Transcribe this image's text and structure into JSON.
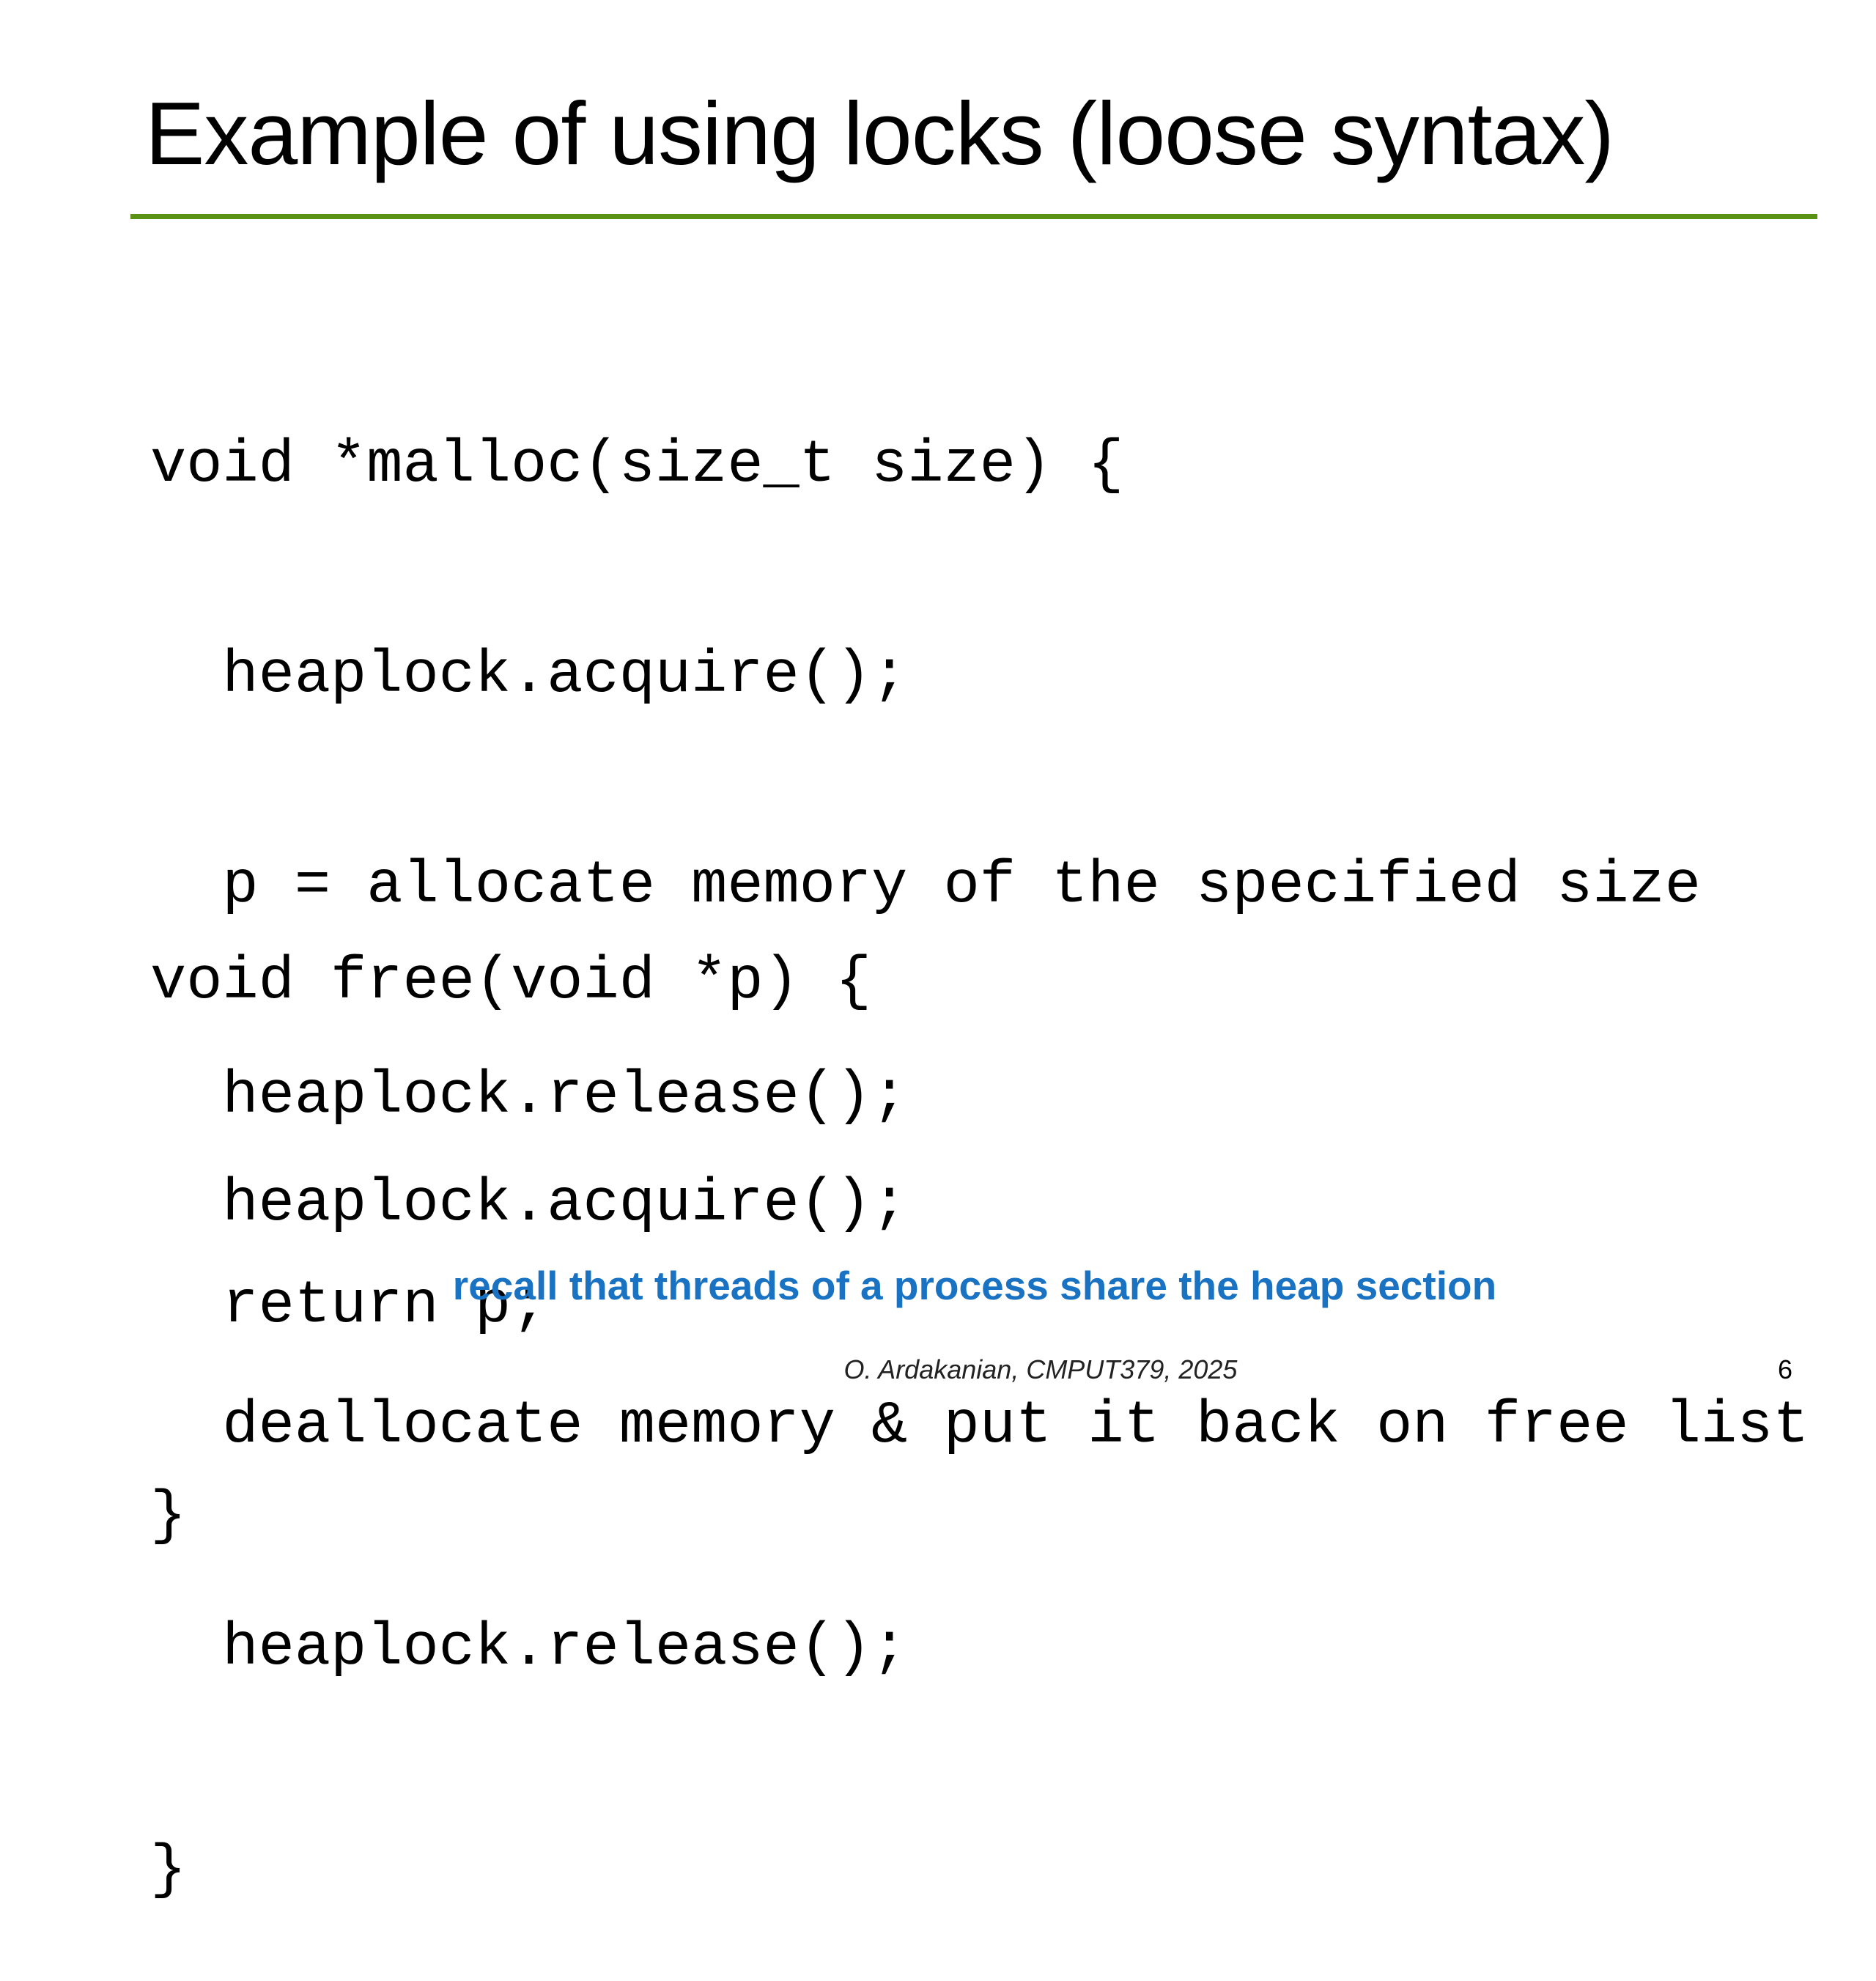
{
  "title": "Example of using locks (loose syntax)",
  "accent_color": "#5a9216",
  "note_color": "#1a73c2",
  "code": {
    "malloc_lines": [
      "void *malloc(size_t size) {",
      "  heaplock.acquire();",
      "  p = allocate memory of the specified size",
      "  heaplock.release();",
      "  return p;",
      "}"
    ],
    "free_lines": [
      "void free(void *p) {",
      "  heaplock.acquire();",
      "  deallocate memory & put it back on free list",
      "  heaplock.release();",
      "}"
    ]
  },
  "note": "recall that threads of a process share the heap section",
  "footer": "O. Ardakanian, CMPUT379, 2025",
  "page_number": "6"
}
